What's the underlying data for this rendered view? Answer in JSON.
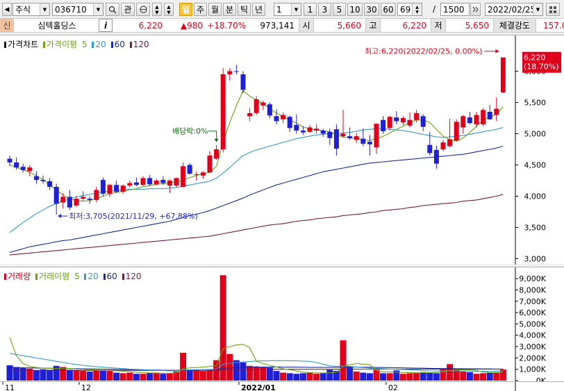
{
  "toolbar": {
    "market": "주식",
    "code": "036710",
    "search_label": "관",
    "periods": [
      "일",
      "주",
      "월",
      "분",
      "틱",
      "년"
    ],
    "selected_period": "일",
    "interval_value": "1",
    "quick_intervals": [
      "1",
      "3",
      "5",
      "10",
      "30",
      "60"
    ],
    "count_value": "69",
    "count_sep": "/",
    "count_total": "1500",
    "date_value": "2022/02/25"
  },
  "quote": {
    "badge": "신",
    "name": "심텍홀딩스",
    "info_label": "i",
    "price": "6,220",
    "change": "▲980",
    "change_rate": "+18.70%",
    "volume": "973,141",
    "open_label": "시",
    "open": "5,660",
    "high_label": "고",
    "high": "6,220",
    "low_label": "저",
    "low": "5,650",
    "strength_label": "체결강도",
    "strength": "157.0"
  },
  "price_panel": {
    "title": "가격차트",
    "ma_title": "가격이평",
    "ma_periods": [
      "5",
      "20",
      "60",
      "120"
    ],
    "colors": {
      "up": "#e0001b",
      "down": "#1f1fd6",
      "ma5": "#6aa50f",
      "ma20": "#3399cc",
      "ma60": "#1a2a9a",
      "ma120": "#7a1a40"
    },
    "y_ticks": [
      "6,000",
      "5,500",
      "5,000",
      "4,500",
      "4,000",
      "3,500",
      "3,000"
    ],
    "last_price": "6,220",
    "last_rate": "(18.70%)",
    "high_note": "최고:6,220(2022/02/25, 0.00%)",
    "low_note": "최저:3,705(2021/11/29, +67.88%)",
    "dividend_note": "배당락:0%"
  },
  "volume_panel": {
    "title": "거래량",
    "ma_title": "거래이평",
    "ma_periods": [
      "5",
      "20",
      "60",
      "120"
    ],
    "y_ticks": [
      "9,000K",
      "8,000K",
      "7,000K",
      "6,000K",
      "5,000K",
      "4,000K",
      "3,000K",
      "2,000K",
      "1,000K",
      "0K"
    ]
  },
  "x_axis": {
    "labels": [
      "11",
      "12",
      "2022/01",
      "02"
    ]
  },
  "chart_data": {
    "type": "candlestick",
    "ylim": [
      2950,
      6350
    ],
    "volume_ylim": [
      0,
      9500
    ],
    "volume_unit": "K",
    "candles": [
      [
        4600,
        4650,
        4480,
        4540
      ],
      [
        4540,
        4620,
        4420,
        4460
      ],
      [
        4470,
        4520,
        4380,
        4420
      ],
      [
        4400,
        4500,
        4320,
        4460
      ],
      [
        4320,
        4400,
        4200,
        4260
      ],
      [
        4260,
        4330,
        4200,
        4240
      ],
      [
        4240,
        4290,
        4100,
        4150
      ],
      [
        4150,
        4200,
        3705,
        3880
      ],
      [
        3900,
        4050,
        3800,
        3990
      ],
      [
        3990,
        4100,
        3780,
        3820
      ],
      [
        3850,
        4000,
        3830,
        3960
      ],
      [
        3960,
        4080,
        3920,
        3990
      ],
      [
        3960,
        4000,
        3880,
        3940
      ],
      [
        3940,
        4150,
        3900,
        4100
      ],
      [
        4260,
        4300,
        4000,
        4040
      ],
      [
        4040,
        4200,
        3990,
        4180
      ],
      [
        4180,
        4250,
        4050,
        4070
      ],
      [
        4070,
        4190,
        4040,
        4170
      ],
      [
        4170,
        4250,
        4150,
        4210
      ],
      [
        4220,
        4300,
        4160,
        4180
      ],
      [
        4180,
        4320,
        4160,
        4290
      ],
      [
        4290,
        4340,
        4160,
        4190
      ],
      [
        4190,
        4280,
        4170,
        4250
      ],
      [
        4260,
        4320,
        4180,
        4210
      ],
      [
        4170,
        4270,
        4050,
        4250
      ],
      [
        4170,
        4300,
        4150,
        4290
      ],
      [
        4150,
        4540,
        4140,
        4480
      ],
      [
        4500,
        4530,
        4340,
        4360
      ],
      [
        4340,
        4400,
        4250,
        4350
      ],
      [
        4330,
        4400,
        4280,
        4380
      ],
      [
        4380,
        4720,
        4370,
        4650
      ],
      [
        4600,
        4820,
        4580,
        4750
      ],
      [
        4750,
        6050,
        4700,
        5950
      ],
      [
        5950,
        6050,
        5850,
        6000
      ],
      [
        6000,
        6100,
        5950,
        5990
      ],
      [
        5950,
        6000,
        5650,
        5700
      ],
      [
        5280,
        5410,
        5200,
        5330
      ],
      [
        5330,
        5600,
        5300,
        5550
      ],
      [
        5450,
        5530,
        5380,
        5500
      ],
      [
        5470,
        5500,
        5250,
        5290
      ],
      [
        5280,
        5390,
        5150,
        5200
      ],
      [
        5230,
        5340,
        5170,
        5300
      ],
      [
        5270,
        5290,
        5030,
        5090
      ],
      [
        5140,
        5310,
        5000,
        5050
      ],
      [
        5050,
        5120,
        4980,
        5020
      ],
      [
        5030,
        5140,
        5010,
        5100
      ],
      [
        5050,
        5150,
        5000,
        5080
      ],
      [
        5050,
        5080,
        4950,
        5000
      ],
      [
        5030,
        5080,
        4820,
        4930
      ],
      [
        5070,
        5150,
        4650,
        4760
      ],
      [
        4960,
        5380,
        4930,
        5000
      ],
      [
        4960,
        5100,
        4900,
        4930
      ],
      [
        4900,
        5010,
        4850,
        4960
      ],
      [
        4920,
        5080,
        4800,
        4840
      ],
      [
        4870,
        4980,
        4650,
        4830
      ],
      [
        4780,
        5150,
        4680,
        5160
      ],
      [
        5220,
        5280,
        5000,
        5040
      ],
      [
        5090,
        5290,
        5050,
        5270
      ],
      [
        5260,
        5360,
        5150,
        5200
      ],
      [
        5180,
        5280,
        5140,
        5250
      ],
      [
        5130,
        5340,
        5100,
        5220
      ],
      [
        5220,
        5380,
        5180,
        5330
      ],
      [
        5280,
        5310,
        5040,
        5110
      ],
      [
        4820,
        5030,
        4650,
        4690
      ],
      [
        4740,
        4810,
        4440,
        4520
      ],
      [
        4750,
        4900,
        4720,
        4860
      ],
      [
        4800,
        5240,
        4780,
        4910
      ],
      [
        4890,
        5230,
        4880,
        5190
      ],
      [
        5100,
        5300,
        5000,
        5280
      ],
      [
        5260,
        5350,
        5150,
        5170
      ],
      [
        5150,
        5350,
        5100,
        5300
      ],
      [
        5150,
        5410,
        5120,
        5380
      ],
      [
        5350,
        5460,
        5220,
        5230
      ],
      [
        5300,
        5580,
        5200,
        5400
      ],
      [
        5660,
        6220,
        5650,
        6220
      ]
    ],
    "volume": [
      1350,
      1200,
      1100,
      1050,
      900,
      1000,
      950,
      1300,
      1200,
      950,
      900,
      850,
      800,
      950,
      900,
      850,
      700,
      650,
      700,
      600,
      600,
      650,
      700,
      600,
      650,
      800,
      2450,
      950,
      900,
      850,
      1000,
      1800,
      9300,
      2350,
      1800,
      1600,
      1300,
      1250,
      1200,
      1150,
      850,
      700,
      650,
      600,
      650,
      700,
      600,
      650,
      950,
      850,
      3550,
      1250,
      800,
      700,
      650,
      950,
      650,
      650,
      900,
      600,
      650,
      700,
      750,
      700,
      650,
      1000,
      1450,
      1050,
      800,
      750,
      600,
      650,
      700,
      750,
      973
    ],
    "ma5": [
      4500,
      4460,
      4420,
      4380,
      4330,
      4260,
      4180,
      4100,
      4020,
      3960,
      3930,
      3920,
      3930,
      3960,
      4000,
      4040,
      4060,
      4080,
      4100,
      4120,
      4150,
      4170,
      4190,
      4200,
      4210,
      4230,
      4260,
      4300,
      4330,
      4360,
      4380,
      4480,
      4860,
      5180,
      5450,
      5690,
      5600,
      5540,
      5480,
      5400,
      5330,
      5270,
      5220,
      5170,
      5110,
      5080,
      5060,
      5050,
      5030,
      4980,
      4950,
      4930,
      4920,
      4900,
      4890,
      4920,
      4960,
      5010,
      5070,
      5120,
      5180,
      5220,
      5220,
      5180,
      5070,
      4960,
      4900,
      4880,
      4930,
      5020,
      5120,
      5220,
      5270,
      5310,
      5430
    ],
    "ma20": [
      3420,
      3500,
      3580,
      3650,
      3720,
      3780,
      3840,
      3880,
      3920,
      3960,
      3990,
      4010,
      4030,
      4050,
      4070,
      4080,
      4090,
      4100,
      4110,
      4110,
      4110,
      4120,
      4120,
      4120,
      4130,
      4140,
      4160,
      4180,
      4200,
      4220,
      4240,
      4290,
      4370,
      4460,
      4560,
      4650,
      4700,
      4740,
      4770,
      4800,
      4830,
      4860,
      4890,
      4920,
      4940,
      4960,
      4980,
      4990,
      5000,
      5000,
      5010,
      5020,
      5040,
      5060,
      5070,
      5080,
      5080,
      5070,
      5060,
      5050,
      5030,
      5010,
      4990,
      4970,
      4950,
      4940,
      4950,
      4960,
      4970,
      4990,
      5010,
      5030,
      5050,
      5070,
      5100
    ],
    "ma60": [
      3100,
      3130,
      3160,
      3190,
      3210,
      3230,
      3250,
      3270,
      3290,
      3300,
      3320,
      3340,
      3360,
      3380,
      3400,
      3420,
      3440,
      3460,
      3480,
      3500,
      3520,
      3540,
      3560,
      3580,
      3600,
      3630,
      3660,
      3690,
      3710,
      3740,
      3770,
      3810,
      3850,
      3890,
      3930,
      3970,
      4020,
      4060,
      4100,
      4140,
      4180,
      4210,
      4240,
      4270,
      4300,
      4330,
      4360,
      4390,
      4410,
      4430,
      4450,
      4470,
      4490,
      4510,
      4530,
      4540,
      4550,
      4560,
      4570,
      4580,
      4590,
      4600,
      4610,
      4620,
      4630,
      4640,
      4650,
      4660,
      4670,
      4690,
      4710,
      4730,
      4750,
      4770,
      4800
    ],
    "ma120": [
      3060,
      3070,
      3080,
      3090,
      3100,
      3110,
      3120,
      3130,
      3140,
      3150,
      3160,
      3170,
      3180,
      3190,
      3200,
      3210,
      3220,
      3230,
      3240,
      3250,
      3260,
      3270,
      3280,
      3290,
      3300,
      3310,
      3320,
      3330,
      3340,
      3350,
      3360,
      3380,
      3400,
      3420,
      3440,
      3460,
      3480,
      3500,
      3520,
      3540,
      3550,
      3560,
      3580,
      3600,
      3610,
      3620,
      3640,
      3650,
      3660,
      3670,
      3690,
      3700,
      3710,
      3720,
      3740,
      3750,
      3770,
      3780,
      3790,
      3800,
      3820,
      3830,
      3850,
      3860,
      3870,
      3880,
      3890,
      3900,
      3920,
      3930,
      3940,
      3960,
      3980,
      4000,
      4030
    ],
    "vma5": [
      3800,
      2200,
      1500,
      1250,
      1150,
      1100,
      1080,
      1060,
      1100,
      1060,
      1020,
      1000,
      960,
      920,
      900,
      880,
      860,
      830,
      780,
      740,
      700,
      680,
      670,
      650,
      650,
      670,
      1050,
      1120,
      1150,
      1190,
      1250,
      1300,
      2800,
      3000,
      3150,
      3200,
      2900,
      1700,
      1500,
      1350,
      1200,
      1050,
      950,
      850,
      750,
      700,
      680,
      660,
      700,
      720,
      1250,
      1400,
      1500,
      1450,
      1400,
      900,
      780,
      760,
      750,
      720,
      700,
      680,
      700,
      700,
      700,
      780,
      880,
      940,
      950,
      950,
      900,
      760,
      710,
      700,
      750
    ],
    "vma20": [
      2400,
      2300,
      2200,
      2100,
      2000,
      1900,
      1800,
      1700,
      1600,
      1500,
      1420,
      1350,
      1280,
      1220,
      1180,
      1140,
      1100,
      1060,
      1020,
      990,
      960,
      930,
      900,
      880,
      860,
      860,
      930,
      950,
      960,
      960,
      970,
      1020,
      1450,
      1530,
      1600,
      1650,
      1690,
      1720,
      1740,
      1760,
      1760,
      1760,
      1750,
      1740,
      1720,
      1700,
      1600,
      1450,
      1300,
      1250,
      1280,
      1250,
      1200,
      1150,
      1100,
      1070,
      1050,
      1020,
      1000,
      980,
      950,
      930,
      880,
      860,
      850,
      850,
      860,
      860,
      860,
      850,
      830,
      830,
      830,
      840,
      850
    ],
    "vma60": [
      1150,
      1140,
      1130,
      1120,
      1110,
      1100,
      1090,
      1080,
      1070,
      1060,
      1050,
      1040,
      1030,
      1020,
      1010,
      1000,
      990,
      980,
      970,
      960,
      950,
      940,
      930,
      920,
      910,
      900,
      920,
      930,
      940,
      950,
      960,
      980,
      1100,
      1120,
      1140,
      1160,
      1170,
      1180,
      1190,
      1200,
      1200,
      1190,
      1190,
      1180,
      1180,
      1170,
      1170,
      1160,
      1160,
      1160,
      1190,
      1190,
      1190,
      1180,
      1170,
      1160,
      1150,
      1140,
      1130,
      1120,
      1110,
      1100,
      1090,
      1080,
      1070,
      1060,
      1060,
      1050,
      1050,
      1040,
      1040,
      1030,
      1030,
      1020,
      1020
    ],
    "vma120": [
      900,
      900,
      900,
      900,
      900,
      900,
      900,
      900,
      900,
      900,
      900,
      900,
      900,
      900,
      900,
      900,
      900,
      900,
      900,
      900,
      900,
      900,
      900,
      900,
      900,
      900,
      910,
      910,
      910,
      910,
      910,
      920,
      960,
      970,
      980,
      990,
      990,
      1000,
      1000,
      1000,
      1000,
      1000,
      1000,
      1000,
      1000,
      1000,
      1000,
      1000,
      1000,
      1000,
      1010,
      1010,
      1010,
      1010,
      1010,
      1010,
      1010,
      1010,
      1010,
      1010,
      1010,
      1010,
      1010,
      1010,
      1010,
      1010,
      1010,
      1010,
      1010,
      1010,
      1010,
      1010,
      1010,
      1010,
      1010
    ]
  }
}
